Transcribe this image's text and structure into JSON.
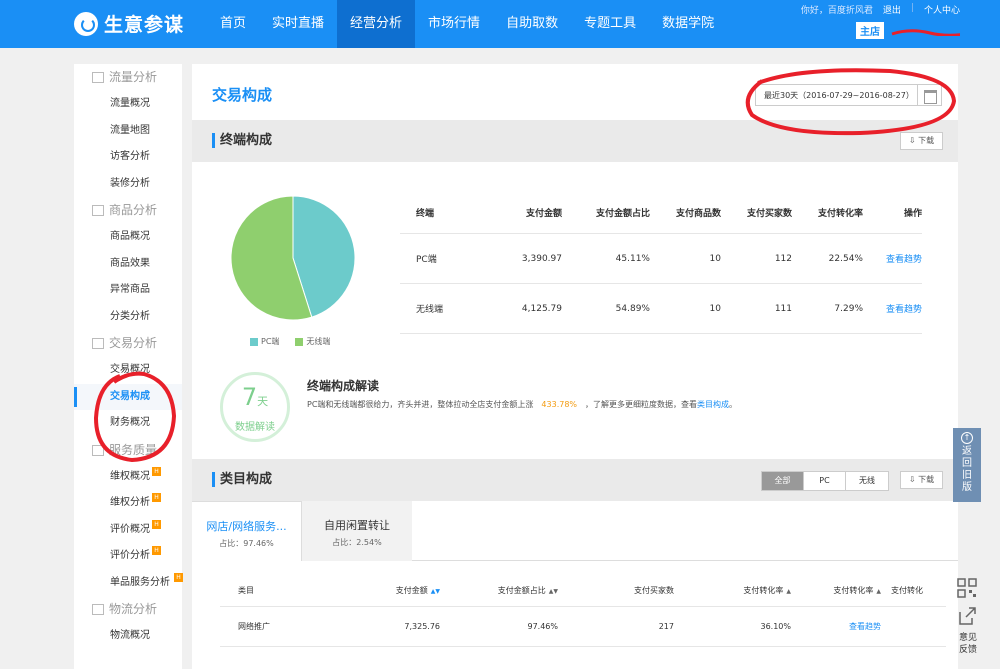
{
  "brand": {
    "name": "生意参谋"
  },
  "nav": [
    {
      "label": "首页",
      "active": false
    },
    {
      "label": "实时直播",
      "active": false
    },
    {
      "label": "经营分析",
      "active": true
    },
    {
      "label": "市场行情",
      "active": false
    },
    {
      "label": "自助取数",
      "active": false
    },
    {
      "label": "专题工具",
      "active": false
    },
    {
      "label": "数据学院",
      "active": false
    }
  ],
  "top_links": {
    "greeting": "你好，百度折风君",
    "logout": "退出",
    "user_center": "个人中心"
  },
  "shop": {
    "badge": "主店"
  },
  "sidebar": {
    "groups": [
      {
        "title": "流量分析",
        "items": [
          "流量概况",
          "流量地图",
          "访客分析",
          "装修分析"
        ]
      },
      {
        "title": "商品分析",
        "items": [
          "商品概况",
          "商品效果",
          "异常商品",
          "分类分析"
        ]
      },
      {
        "title": "交易分析",
        "items": [
          "交易概况",
          "交易构成",
          "财务概况"
        ]
      },
      {
        "title": "服务质量",
        "items": [
          "维权概况",
          "维权分析",
          "评价概况",
          "评价分析",
          "单品服务分析"
        ]
      },
      {
        "title": "物流分析",
        "items": [
          "物流概况"
        ]
      }
    ],
    "active_item": "交易构成",
    "hot_label": "H"
  },
  "main": {
    "title": "交易构成",
    "date_range": "最近30天（2016-07-29~2016-08-27）",
    "download_label": "下载"
  },
  "terminal": {
    "section_title": "终端构成",
    "legend": [
      "PC端",
      "无线端"
    ],
    "colors": {
      "pc": "#6ccbcb",
      "wireless": "#8fcf6e"
    },
    "columns": [
      "终端",
      "支付金额",
      "支付金额占比",
      "支付商品数",
      "支付买家数",
      "支付转化率",
      "操作"
    ],
    "rows": [
      {
        "terminal": "PC端",
        "amount": "3,390.97",
        "share": "45.11%",
        "goods": "10",
        "buyers": "112",
        "conversion": "22.54%",
        "action": "查看趋势"
      },
      {
        "terminal": "无线端",
        "amount": "4,125.79",
        "share": "54.89%",
        "goods": "10",
        "buyers": "111",
        "conversion": "7.29%",
        "action": "查看趋势"
      }
    ],
    "chart_data": {
      "type": "pie",
      "categories": [
        "PC端",
        "无线端"
      ],
      "values": [
        45.11,
        54.89
      ]
    }
  },
  "interpretation": {
    "days": "7",
    "days_unit": "天",
    "badge_label": "数据解读",
    "title": "终端构成解读",
    "text_before": "PC端和无线端都很给力，齐头并进，整体拉动全店支付金额上涨",
    "pct": "433.78%",
    "text_after": "，了解更多更细粒度数据，查看",
    "link": "类目构成",
    "end": "。"
  },
  "category": {
    "section_title": "类目构成",
    "filters": [
      "全部",
      "PC",
      "无线"
    ],
    "active_filter": "全部",
    "tabs": [
      {
        "name": "网店/网络服务...",
        "share": "占比：97.46%"
      },
      {
        "name": "自用闲置转让",
        "share": "占比：2.54%"
      }
    ],
    "columns": [
      "类目",
      "支付金额",
      "支付金额占比",
      "支付买家数",
      "支付转化率",
      "支付转化率",
      "支付转化"
    ],
    "rows": [
      {
        "name": "网络推广",
        "amount": "7,325.76",
        "share": "97.46%",
        "buyers": "217",
        "conversion": "36.10%",
        "action": "查看趋势"
      }
    ]
  },
  "float_tools": {
    "old_version": [
      "返",
      "回",
      "旧",
      "版"
    ],
    "feedback": [
      "意见",
      "反馈"
    ]
  }
}
